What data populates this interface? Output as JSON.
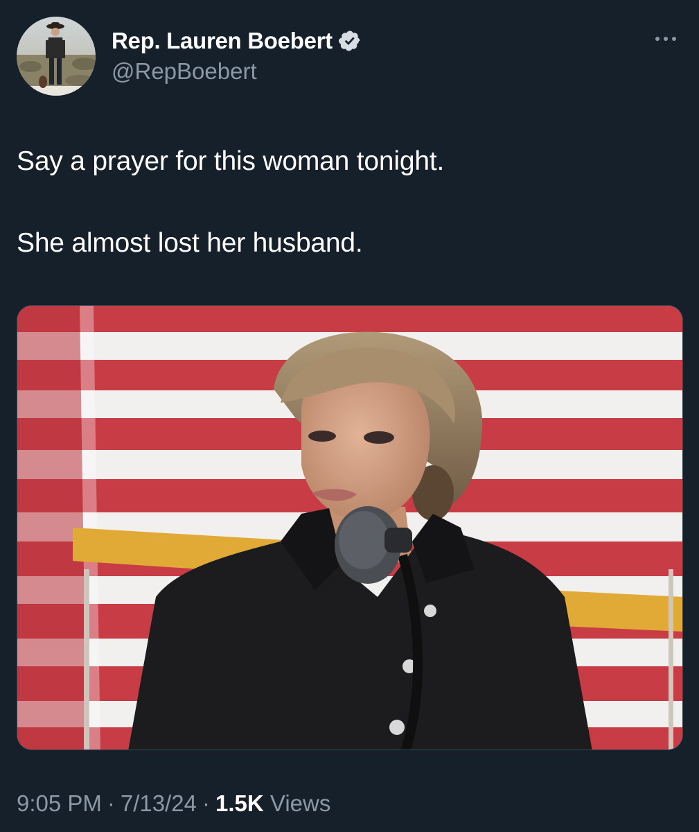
{
  "author": {
    "display_name": "Rep. Lauren Boebert",
    "handle": "@RepBoebert",
    "verified_icon": "verified-badge-icon",
    "avatar_icon": "avatar"
  },
  "tweet": {
    "lines": [
      "Say a prayer for this woman tonight.",
      "She almost lost her husband."
    ]
  },
  "meta": {
    "time": "9:05 PM",
    "separator": "·",
    "date": "7/13/24",
    "views_count": "1.5K",
    "views_label": "Views"
  },
  "colors": {
    "background": "#15202b",
    "text": "#ffffff",
    "secondary_text": "#8b98a5",
    "verified": "#d6dde3"
  }
}
